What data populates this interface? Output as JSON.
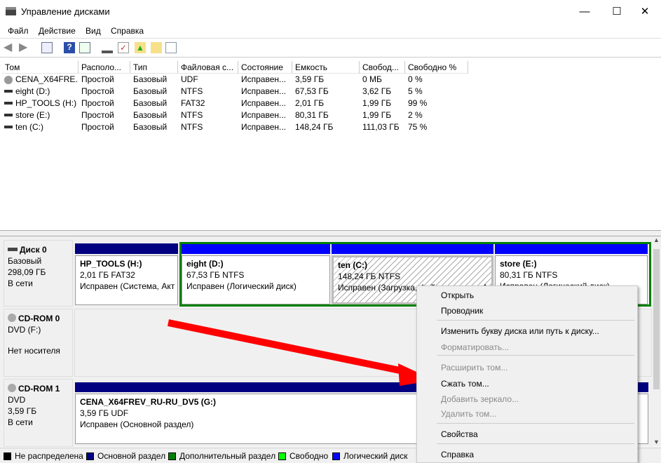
{
  "window": {
    "title": "Управление дисками"
  },
  "menu": [
    "Файл",
    "Действие",
    "Вид",
    "Справка"
  ],
  "table": {
    "columns": [
      "Том",
      "Располо...",
      "Тип",
      "Файловая с...",
      "Состояние",
      "Емкость",
      "Свобод...",
      "Свободно %"
    ],
    "rows": [
      [
        "CENA_X64FRE...",
        "Простой",
        "Базовый",
        "UDF",
        "Исправен...",
        "3,59 ГБ",
        "0 МБ",
        "0 %"
      ],
      [
        "eight (D:)",
        "Простой",
        "Базовый",
        "NTFS",
        "Исправен...",
        "67,53 ГБ",
        "3,62 ГБ",
        "5 %"
      ],
      [
        "HP_TOOLS (H:)",
        "Простой",
        "Базовый",
        "FAT32",
        "Исправен...",
        "2,01 ГБ",
        "1,99 ГБ",
        "99 %"
      ],
      [
        "store (E:)",
        "Простой",
        "Базовый",
        "NTFS",
        "Исправен...",
        "80,31 ГБ",
        "1,99 ГБ",
        "2 %"
      ],
      [
        "ten (C:)",
        "Простой",
        "Базовый",
        "NTFS",
        "Исправен...",
        "148,24 ГБ",
        "111,03 ГБ",
        "75 %"
      ]
    ]
  },
  "disks": [
    {
      "name": "Диск 0",
      "type": "Базовый",
      "size": "298,09 ГБ",
      "status": "В сети",
      "partitions": [
        {
          "name": "HP_TOOLS  (H:)",
          "size": "2,01 ГБ FAT32",
          "status": "Исправен (Система, Акт"
        },
        {
          "name": "eight  (D:)",
          "size": "67,53 ГБ NTFS",
          "status": "Исправен (Логический диск)"
        },
        {
          "name": "ten  (C:)",
          "size": "148,24 ГБ NTFS",
          "status": "Исправен (Загрузка, Файл подкачки, Ав"
        },
        {
          "name": "store  (E:)",
          "size": "80,31 ГБ NTFS",
          "status": "Исправен (Логический диск)"
        }
      ]
    },
    {
      "name": "CD-ROM 0",
      "type": "DVD (F:)",
      "status": "Нет носителя"
    },
    {
      "name": "CD-ROM 1",
      "type": "DVD",
      "size": "3,59 ГБ",
      "status": "В сети",
      "partitions": [
        {
          "name": "CENA_X64FREV_RU-RU_DV5  (G:)",
          "size": "3,59 ГБ UDF",
          "status": "Исправен (Основной раздел)"
        }
      ]
    }
  ],
  "legend": [
    {
      "label": "Не распределена",
      "color": "#000000"
    },
    {
      "label": "Основной раздел",
      "color": "#000080"
    },
    {
      "label": "Дополнительный раздел",
      "color": "#008000"
    },
    {
      "label": "Свободно",
      "color": "#00ff00"
    },
    {
      "label": "Логический диск",
      "color": "#0000ff"
    }
  ],
  "context_menu": [
    {
      "label": "Открыть",
      "enabled": true
    },
    {
      "label": "Проводник",
      "enabled": true
    },
    {
      "label": "Изменить букву диска или путь к диску...",
      "enabled": true
    },
    {
      "label": "Форматировать...",
      "enabled": false
    },
    {
      "label": "Расширить том...",
      "enabled": false
    },
    {
      "label": "Сжать том...",
      "enabled": true
    },
    {
      "label": "Добавить зеркало...",
      "enabled": false
    },
    {
      "label": "Удалить том...",
      "enabled": false
    },
    {
      "label": "Свойства",
      "enabled": true
    },
    {
      "label": "Справка",
      "enabled": true
    }
  ]
}
